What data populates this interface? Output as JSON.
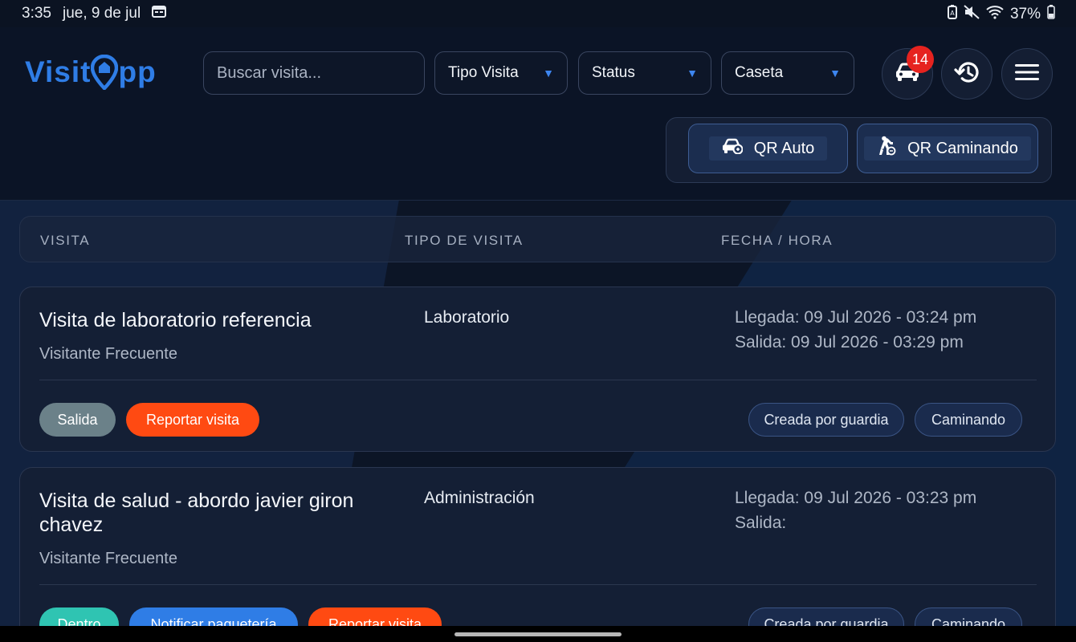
{
  "status_bar": {
    "time": "3:35",
    "date": "jue, 9 de jul",
    "battery": "37%"
  },
  "header": {
    "logo": {
      "pre": "Visit",
      "post": "pp"
    },
    "search": {
      "placeholder": "Buscar visita..."
    },
    "filters": [
      {
        "label": "Tipo Visita"
      },
      {
        "label": "Status"
      },
      {
        "label": "Caseta"
      }
    ],
    "notifications": {
      "count": "14"
    },
    "qr_auto_label": "QR Auto",
    "qr_walk_label": "QR Caminando"
  },
  "table": {
    "columns": [
      "VISITA",
      "TIPO DE VISITA",
      "FECHA / HORA"
    ],
    "rows": [
      {
        "title": "Visita de laboratorio referencia",
        "subtitle": "Visitante Frecuente",
        "type": "Laboratorio",
        "arrival": "Llegada: 09 Jul 2026 - 03:24 pm",
        "departure": "Salida: 09 Jul 2026 - 03:29 pm",
        "status": "Salida",
        "actions": [
          "Reportar visita"
        ],
        "tags": [
          "Creada por guardia",
          "Caminando"
        ]
      },
      {
        "title": "Visita de salud - abordo javier giron chavez",
        "subtitle": "Visitante Frecuente",
        "type": "Administración",
        "arrival": "Llegada: 09 Jul 2026 - 03:23 pm",
        "departure": "Salida:",
        "status": "Dentro",
        "actions": [
          "Notificar paquetería",
          "Reportar visita"
        ],
        "tags": [
          "Creada por guardia",
          "Caminando"
        ]
      }
    ]
  },
  "colors": {
    "accent": "#2f7de6",
    "status_out": "#6b8189",
    "status_in": "#2fc4b2",
    "report": "#ff4a12",
    "notify": "#2f7de6",
    "badge": "#e6231f"
  }
}
